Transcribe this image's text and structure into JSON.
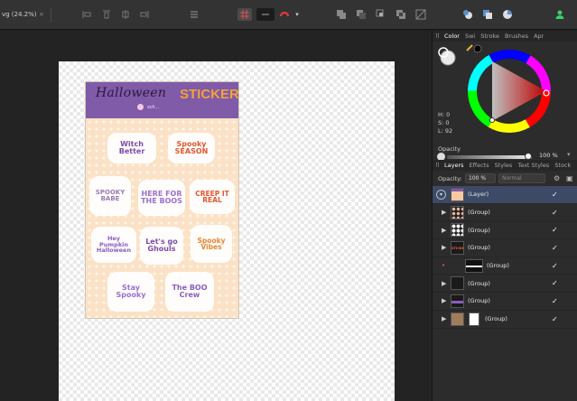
{
  "toolbar": {
    "document_tab": "vg (24.2%)",
    "close_glyph": "×",
    "dropdown_glyph": "▾"
  },
  "sheet": {
    "title_script": "Halloween",
    "title_bold": "STICKERS",
    "subtitle": "sch..."
  },
  "stickers": [
    {
      "text": "Witch Better",
      "color": "#7d4aa8"
    },
    {
      "text": "Spooky SEASON",
      "color": "#e0562f"
    },
    {
      "text": "SPOOKY BABE",
      "color": "#9a7ab8"
    },
    {
      "text": "HERE FOR THE BOOS",
      "color": "#9b6fd0"
    },
    {
      "text": "CREEP IT REAL",
      "color": "#e0562f"
    },
    {
      "text": "Hey Pumpkin Halloween",
      "color": "#8a5cc0"
    },
    {
      "text": "Let's go Ghouls",
      "color": "#7d4aa8"
    },
    {
      "text": "Spooky Vibes",
      "color": "#e8842f"
    },
    {
      "text": "Stay Spooky",
      "color": "#9b6fd0"
    },
    {
      "text": "The BOO Crew",
      "color": "#8a5cc0"
    }
  ],
  "panel": {
    "color_tabs": [
      {
        "label": "Color",
        "active": true
      },
      {
        "label": "Swi",
        "active": false
      },
      {
        "label": "Stroke",
        "active": false
      },
      {
        "label": "Brushes",
        "active": false
      },
      {
        "label": "Apr",
        "active": false
      }
    ],
    "hsl": {
      "h": "H: 0",
      "s": "S: 0",
      "l": "L: 92"
    },
    "opacity_label": "Opacity",
    "opacity_value": "100 %",
    "opacity_fraction": 1.0,
    "layer_tabs": [
      {
        "label": "Layers",
        "active": true
      },
      {
        "label": "Effects",
        "active": false
      },
      {
        "label": "Styles",
        "active": false
      },
      {
        "label": "Text Styles",
        "active": false
      },
      {
        "label": "Stock",
        "active": false
      }
    ],
    "layer_opacity_label": "Opacity:",
    "layer_opacity_value": "100 %",
    "blend_mode": "Normal",
    "layers": [
      {
        "name": "(Layer)",
        "selected": true,
        "thumb": "sheet"
      },
      {
        "name": "(Group)",
        "selected": false,
        "thumb": "dots"
      },
      {
        "name": "(Group)",
        "selected": false,
        "thumb": "dots2"
      },
      {
        "name": "(Group)",
        "selected": false,
        "thumb": "stickers"
      },
      {
        "name": "(Group)",
        "selected": false,
        "thumb": "bar"
      },
      {
        "name": "(Group)",
        "selected": false,
        "thumb": "dark"
      },
      {
        "name": "(Group)",
        "selected": false,
        "thumb": "purple"
      },
      {
        "name": "(Group)",
        "selected": false,
        "thumb": "brown"
      }
    ],
    "layer_thumb_text_stickers": "STICKERS",
    "check_glyph": "✓",
    "arrow_glyph": "▶"
  },
  "colors": {
    "accent_selected": "#3c4a66",
    "sheet_purple": "#7f5ba8",
    "sheet_orange": "#f3a23a"
  }
}
